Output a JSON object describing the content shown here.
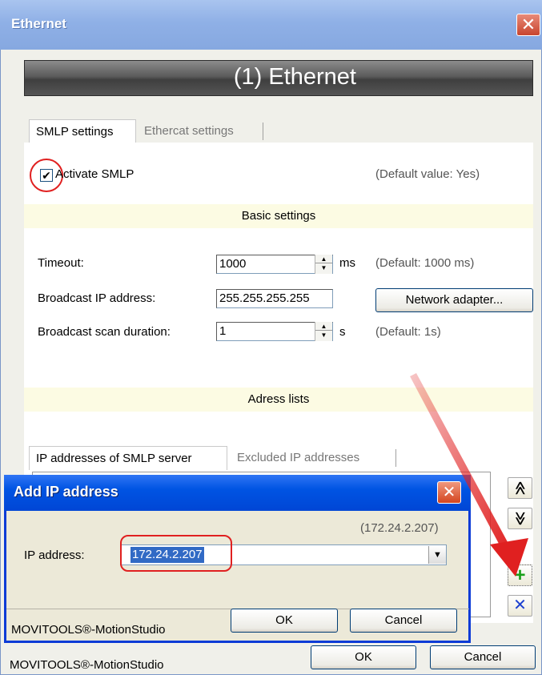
{
  "window": {
    "title": "Ethernet",
    "close_glyph": "✕",
    "banner": "(1) Ethernet",
    "footer_brand": "MOVITOOLS®-MotionStudio",
    "ok_label": "OK",
    "cancel_label": "Cancel"
  },
  "tabs": [
    {
      "label": "SMLP settings",
      "active": true
    },
    {
      "label": "Ethercat settings",
      "active": false
    }
  ],
  "smlp": {
    "activate_label": "Activate SMLP",
    "activate_checked": true,
    "check_glyph": "✔",
    "activate_default": "(Default value: Yes)"
  },
  "basic_settings": {
    "header": "Basic settings",
    "timeout_label": "Timeout:",
    "timeout_value": "1000",
    "timeout_unit": "ms",
    "timeout_default": "(Default: 1000 ms)",
    "broadcast_ip_label": "Broadcast IP address:",
    "broadcast_ip_value": "255.255.255.255",
    "network_adapter_button": "Network adapter...",
    "scan_duration_label": "Broadcast scan duration:",
    "scan_duration_value": "1",
    "scan_duration_unit": "s",
    "scan_duration_default": "(Default: 1s)"
  },
  "address_lists": {
    "header": "Adress lists",
    "tabs": [
      {
        "label": "IP addresses of SMLP server",
        "active": true
      },
      {
        "label": "Excluded IP addresses",
        "active": false
      }
    ],
    "icons": {
      "move_up": "≪",
      "move_down": "≫",
      "add": "+",
      "remove": "✕"
    }
  },
  "dialog": {
    "title": "Add IP address",
    "close_glyph": "✕",
    "hint": "(172.24.2.207)",
    "ip_label": "IP address:",
    "ip_value": "172.24.2.207",
    "footer_brand": "MOVITOOLS®-MotionStudio",
    "ok_label": "OK",
    "cancel_label": "Cancel"
  },
  "colors": {
    "annotation_red": "#e02020",
    "dialog_title_blue": "#0054e3",
    "add_green": "#1aa01a",
    "remove_blue": "#1c3fd0"
  }
}
